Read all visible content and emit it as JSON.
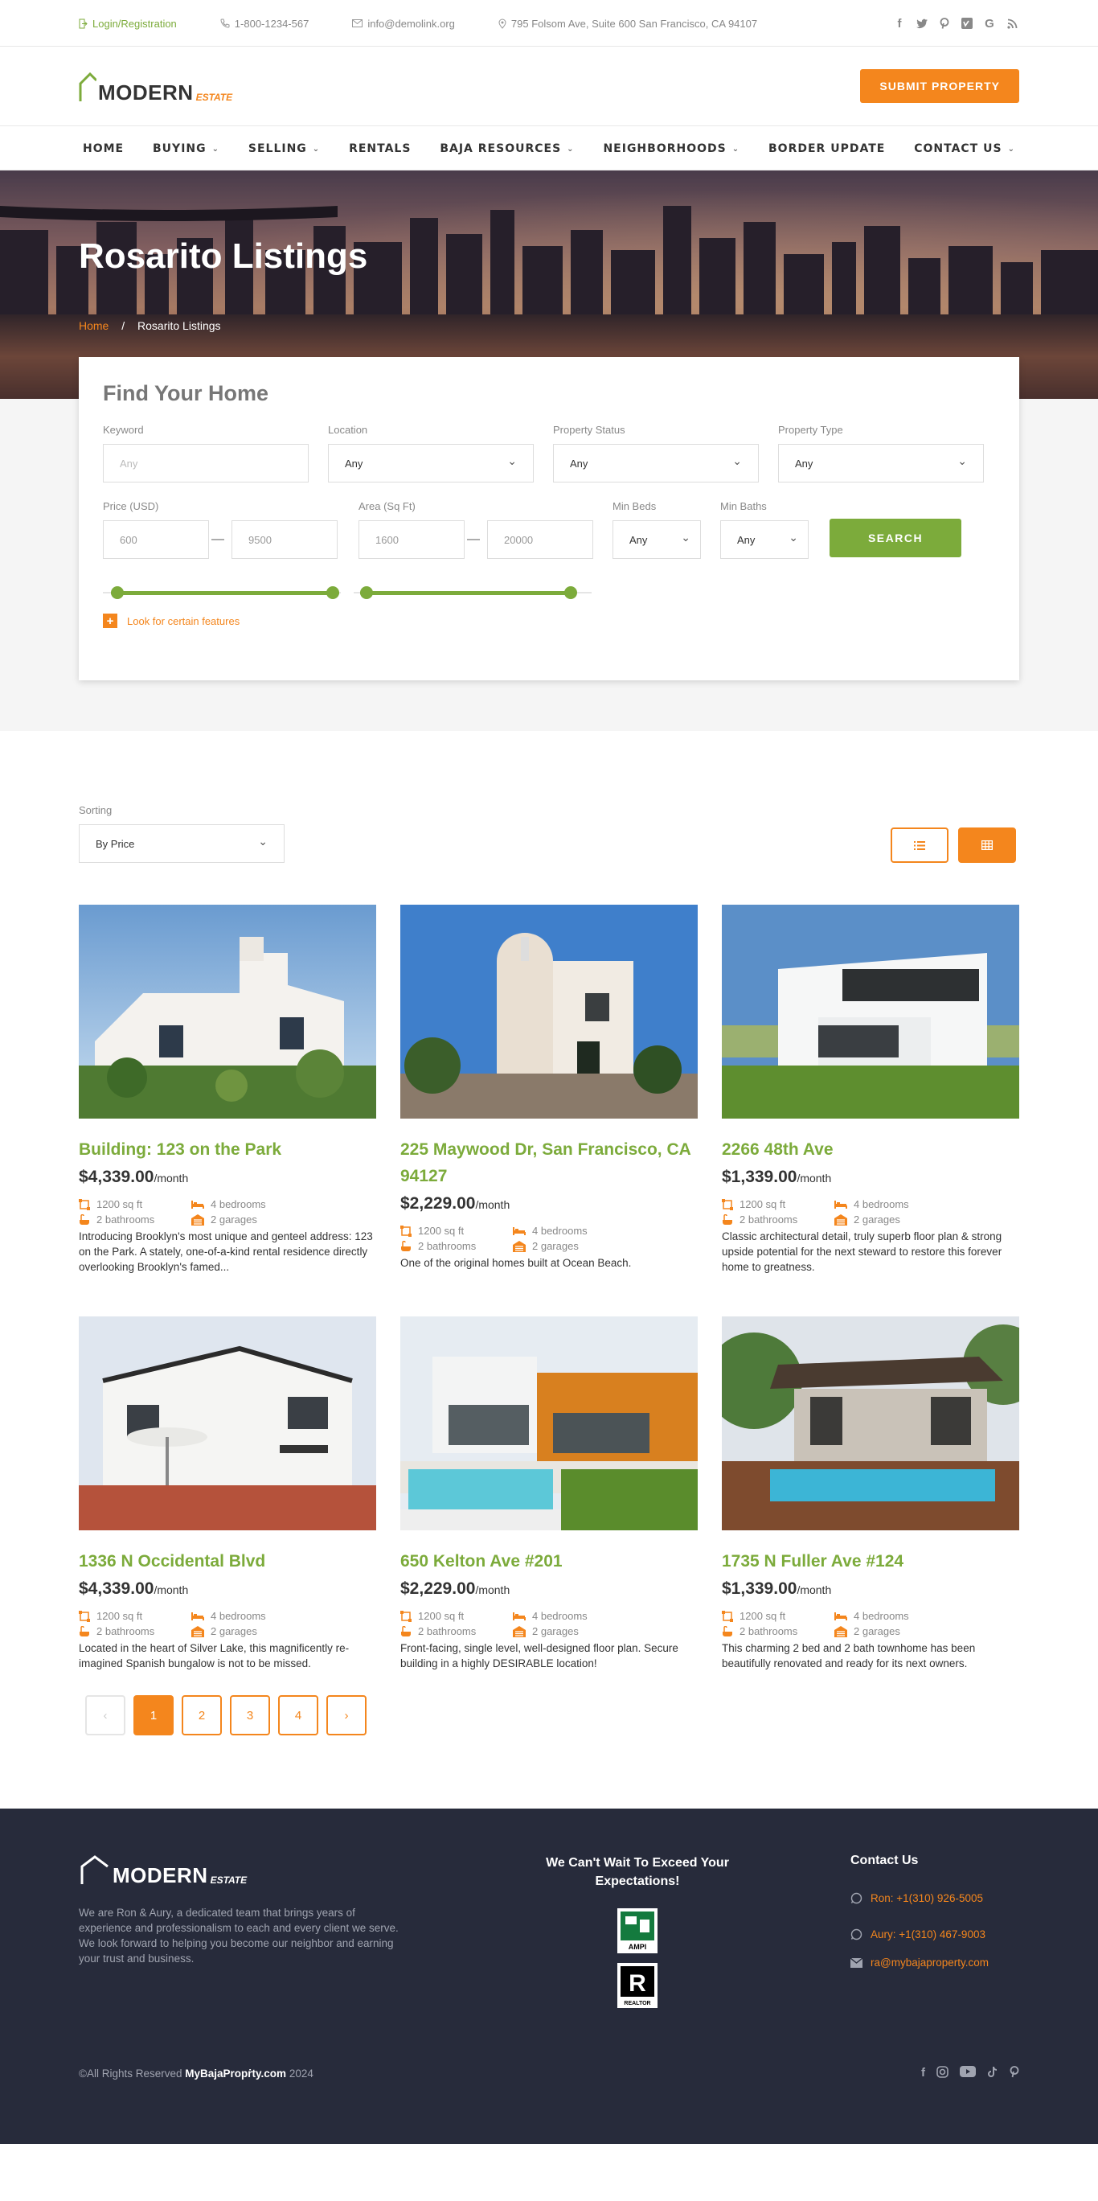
{
  "topbar": {
    "login": "Login/Registration",
    "phone": "1-800-1234-567",
    "email": "info@demolink.org",
    "address": "795 Folsom Ave, Suite 600 San Francisco, CA 94107",
    "socials": [
      "facebook-icon",
      "twitter-icon",
      "pinterest-icon",
      "vimeo-icon",
      "google-icon",
      "rss-icon"
    ]
  },
  "header": {
    "logo_main": "MODERN",
    "logo_sub": "ESTATE",
    "submit_label": "SUBMIT PROPERTY"
  },
  "nav": {
    "items": [
      {
        "label": "HOME",
        "dropdown": false
      },
      {
        "label": "BUYING",
        "dropdown": true
      },
      {
        "label": "SELLING",
        "dropdown": true
      },
      {
        "label": "RENTALS",
        "dropdown": false
      },
      {
        "label": "BAJA RESOURCES",
        "dropdown": true
      },
      {
        "label": "NEIGHBORHOODS",
        "dropdown": true
      },
      {
        "label": "BORDER UPDATE",
        "dropdown": false
      },
      {
        "label": "CONTACT US",
        "dropdown": true
      }
    ]
  },
  "hero": {
    "title": "Rosarito Listings",
    "breadcrumb_home": "Home",
    "breadcrumb_sep": "/",
    "breadcrumb_current": "Rosarito Listings"
  },
  "search": {
    "title": "Find Your Home",
    "keyword_label": "Keyword",
    "keyword_placeholder": "Any",
    "location_label": "Location",
    "location_value": "Any",
    "status_label": "Property Status",
    "status_value": "Any",
    "type_label": "Property Type",
    "type_value": "Any",
    "price_label": "Price (USD)",
    "price_min": "600",
    "price_max": "9500",
    "area_label": "Area (Sq Ft)",
    "area_min": "1600",
    "area_max": "20000",
    "beds_label": "Min Beds",
    "beds_value": "Any",
    "baths_label": "Min Baths",
    "baths_value": "Any",
    "dash": "—",
    "search_label": "SEARCH",
    "features_label": "Look for certain features"
  },
  "listing": {
    "sorting_label": "Sorting",
    "sorting_value": "By Price",
    "cards": [
      {
        "title": "Building: 123 on the Park",
        "price": "$4,339.00",
        "per": "/month",
        "area": "1200 sq ft",
        "beds": "4 bedrooms",
        "baths": "2 bathrooms",
        "garages": "2 garages",
        "desc": "Introducing Brooklyn's most unique and genteel address: 123 on the Park. A stately, one-of-a-kind rental residence directly overlooking Brooklyn's famed..."
      },
      {
        "title": "225 Maywood Dr, San Francisco, CA 94127",
        "price": "$2,229.00",
        "per": "/month",
        "area": "1200 sq ft",
        "beds": "4 bedrooms",
        "baths": "2 bathrooms",
        "garages": "2 garages",
        "desc": "One of the original homes built at Ocean Beach."
      },
      {
        "title": "2266 48th Ave",
        "price": "$1,339.00",
        "per": "/month",
        "area": "1200 sq ft",
        "beds": "4 bedrooms",
        "baths": "2 bathrooms",
        "garages": "2 garages",
        "desc": "Classic architectural detail, truly superb floor plan & strong upside potential for the next steward to restore this forever home to greatness."
      },
      {
        "title": "1336 N Occidental Blvd",
        "price": "$4,339.00",
        "per": "/month",
        "area": "1200 sq ft",
        "beds": "4 bedrooms",
        "baths": "2 bathrooms",
        "garages": "2 garages",
        "desc": "Located in the heart of Silver Lake, this magnificently re-imagined Spanish bungalow is not to be missed."
      },
      {
        "title": "650 Kelton Ave #201",
        "price": "$2,229.00",
        "per": "/month",
        "area": "1200 sq ft",
        "beds": "4 bedrooms",
        "baths": "2 bathrooms",
        "garages": "2 garages",
        "desc": "Front-facing, single level, well-designed floor plan. Secure building in a highly DESIRABLE location!"
      },
      {
        "title": "1735 N Fuller Ave #124",
        "price": "$1,339.00",
        "per": "/month",
        "area": "1200 sq ft",
        "beds": "4 bedrooms",
        "baths": "2 bathrooms",
        "garages": "2 garages",
        "desc": "This charming 2 bed and 2 bath townhome has been beautifully renovated and ready for its next owners."
      }
    ],
    "pagination": {
      "prev": "‹",
      "pages": [
        "1",
        "2",
        "3",
        "4"
      ],
      "next": "›",
      "current": "1"
    }
  },
  "footer": {
    "logo_main": "MODERN",
    "logo_sub": "ESTATE",
    "about": "We are Ron & Aury, a dedicated team that brings years of experience and professionalism to each and every client we serve. We look forward to helping you become our neighbor and earning your trust and business.",
    "mid_heading": "We Can't Wait To Exceed Your Expectations!",
    "badge_ampi": "AMPI",
    "badge_realtor": "REALTOR",
    "contact_heading": "Contact Us",
    "contact_ron": "Ron: +1(310) 926-5005",
    "contact_aury": "Aury: +1(310) 467-9003",
    "contact_email": "ra@mybajaproperty.com",
    "copyright_prefix": "©All Rights Reserved",
    "copyright_brand": "MyBajaPropṙty.com",
    "copyright_year": "2024",
    "socials": [
      "facebook-icon",
      "instagram-icon",
      "youtube-icon",
      "tiktok-icon",
      "pinterest-icon"
    ]
  },
  "colors": {
    "accent": "#f4861d",
    "green": "#7cab3b",
    "footer": "#272b3b"
  }
}
